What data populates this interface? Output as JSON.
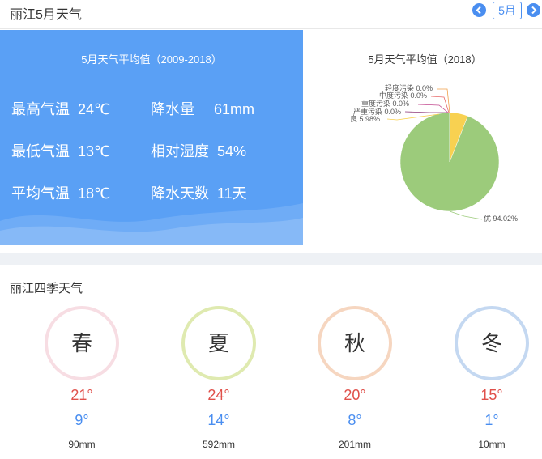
{
  "header": {
    "title": "丽江5月天气",
    "month": "5月",
    "prev_icon": "chevron-left-icon",
    "next_icon": "chevron-right-icon",
    "accent": "#4a8ef0"
  },
  "stats_panel": {
    "title": "5月天气平均值（2009-2018）",
    "bg_color": "#5aa0f5",
    "items": [
      {
        "label": "最高气温",
        "value": "24℃"
      },
      {
        "label": "降水量",
        "value": "61mm"
      },
      {
        "label": "最低气温",
        "value": "13℃"
      },
      {
        "label": "相对湿度",
        "value": "54%"
      },
      {
        "label": "平均气温",
        "value": "18℃"
      },
      {
        "label": "降水天数",
        "value": "11天"
      }
    ]
  },
  "air_quality": {
    "title": "5月天气平均值（2018）",
    "chart_data": {
      "type": "pie",
      "title": "5月天气平均值（2018）",
      "slices": [
        {
          "label": "优",
          "value": 94.02,
          "text": "优 94.02%",
          "color": "#9ccb7b"
        },
        {
          "label": "良",
          "value": 5.98,
          "text": "良 5.98%",
          "color": "#f8d151"
        },
        {
          "label": "轻度污染",
          "value": 0.0,
          "text": "轻度污染 0.0%",
          "color": "#f0a04b"
        },
        {
          "label": "中度污染",
          "value": 0.0,
          "text": "中度污染 0.0%",
          "color": "#e86a6a"
        },
        {
          "label": "重度污染",
          "value": 0.0,
          "text": "重度污染 0.0%",
          "color": "#c34a8f"
        },
        {
          "label": "严重污染",
          "value": 0.0,
          "text": "严重污染 0.0%",
          "color": "#8e3a7a"
        }
      ]
    }
  },
  "seasons_section": {
    "title": "丽江四季天气",
    "seasons": [
      {
        "name": "春",
        "high": "21°",
        "low": "9°",
        "rain": "90mm",
        "ring_color": "#f7dde3"
      },
      {
        "name": "夏",
        "high": "24°",
        "low": "14°",
        "rain": "592mm",
        "ring_color": "#dfeab0"
      },
      {
        "name": "秋",
        "high": "20°",
        "low": "8°",
        "rain": "201mm",
        "ring_color": "#f6d6c0"
      },
      {
        "name": "冬",
        "high": "15°",
        "low": "1°",
        "rain": "10mm",
        "ring_color": "#c4d8f1"
      }
    ]
  }
}
